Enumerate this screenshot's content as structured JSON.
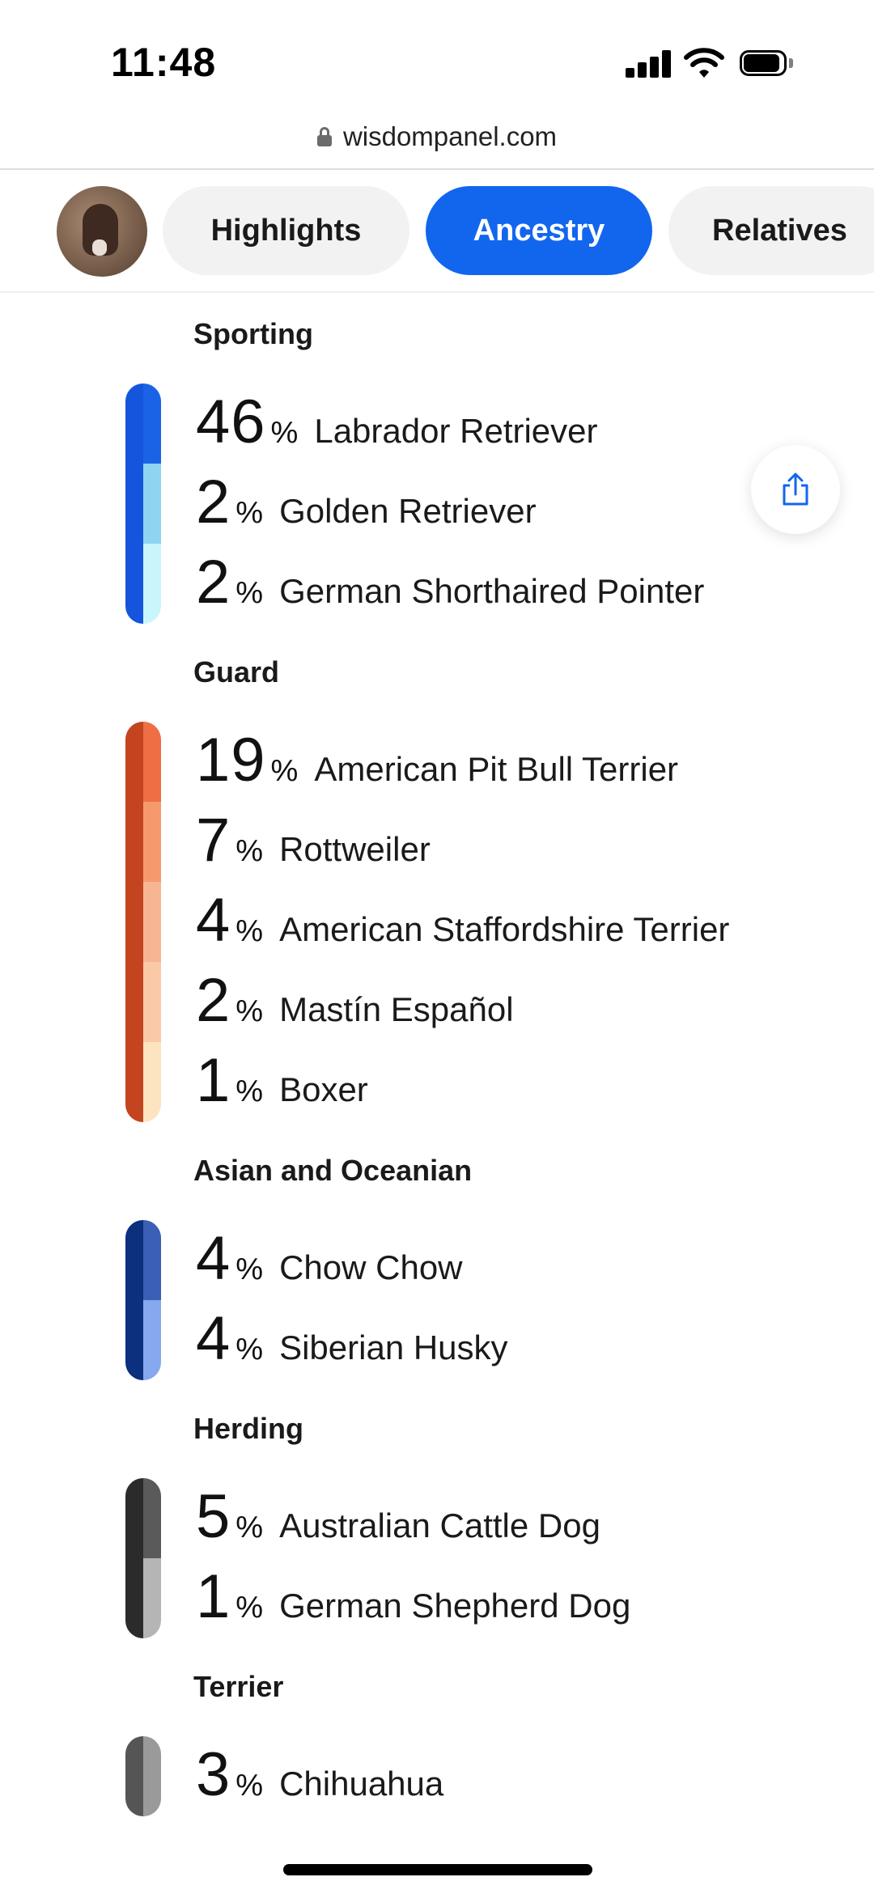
{
  "status": {
    "time": "11:48"
  },
  "browser": {
    "url": "wisdompanel.com"
  },
  "tabs": [
    {
      "label": "Highlights",
      "active": false
    },
    {
      "label": "Ancestry",
      "active": true
    },
    {
      "label": "Relatives",
      "active": false
    }
  ],
  "colors": {
    "accent": "#1266ee"
  },
  "groups": [
    {
      "heading": "Sporting",
      "breeds": [
        {
          "pct": "46",
          "sign": "%",
          "name": "Labrador Retriever",
          "color": "#1a63e6"
        },
        {
          "pct": "2",
          "sign": "%",
          "name": "Golden Retriever",
          "color": "#8fd4f0"
        },
        {
          "pct": "2",
          "sign": "%",
          "name": "German Shorthaired Pointer",
          "color": "#c9f6fa"
        }
      ]
    },
    {
      "heading": "Guard",
      "breeds": [
        {
          "pct": "19",
          "sign": "%",
          "name": "American Pit Bull Terrier",
          "color": "#ef6f44"
        },
        {
          "pct": "7",
          "sign": "%",
          "name": "Rottweiler",
          "color": "#f69a6e"
        },
        {
          "pct": "4",
          "sign": "%",
          "name": "American Staffordshire Terrier",
          "color": "#f8b593"
        },
        {
          "pct": "2",
          "sign": "%",
          "name": "Mastín Español",
          "color": "#fac9a8"
        },
        {
          "pct": "1",
          "sign": "%",
          "name": "Boxer",
          "color": "#fde4c0"
        }
      ]
    },
    {
      "heading": "Asian and Oceanian",
      "breeds": [
        {
          "pct": "4",
          "sign": "%",
          "name": "Chow Chow",
          "color": "#3a5fb5"
        },
        {
          "pct": "4",
          "sign": "%",
          "name": "Siberian Husky",
          "color": "#86a8ee"
        }
      ]
    },
    {
      "heading": "Herding",
      "breeds": [
        {
          "pct": "5",
          "sign": "%",
          "name": "Australian Cattle Dog",
          "color": "#5a5a5a"
        },
        {
          "pct": "1",
          "sign": "%",
          "name": "German Shepherd Dog",
          "color": "#b5b5b5"
        }
      ]
    },
    {
      "heading": "Terrier",
      "breeds": [
        {
          "pct": "3",
          "sign": "%",
          "name": "Chihuahua",
          "color": "#9a9a9a"
        }
      ]
    }
  ],
  "group_bar_colors": [
    "#1554dc",
    "#c4441f",
    "#0c2f7e",
    "#2b2b2b",
    "#555555"
  ]
}
